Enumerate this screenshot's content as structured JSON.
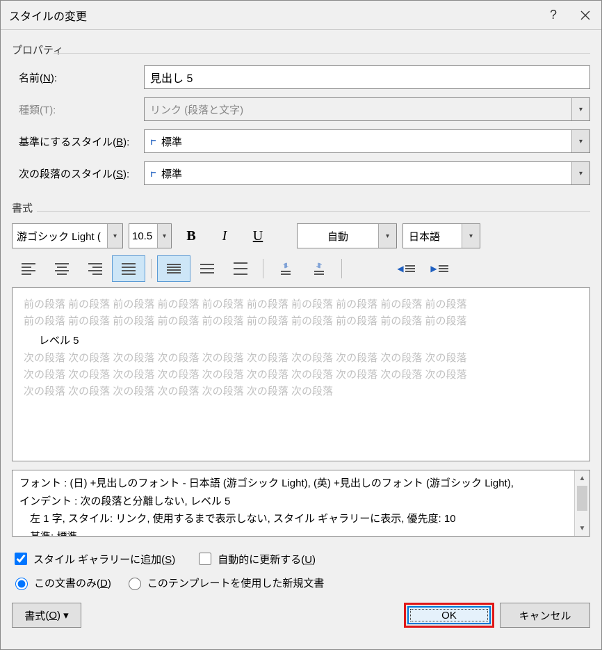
{
  "title": "スタイルの変更",
  "groups": {
    "properties": "プロパティ",
    "format": "書式"
  },
  "labels": {
    "name": "名前",
    "name_key": "N",
    "type": "種類",
    "type_key": "T",
    "based_on": "基準にするスタイル",
    "based_on_key": "B",
    "next_para": "次の段落のスタイル",
    "next_para_key": "S"
  },
  "values": {
    "name": "見出し 5",
    "type": "リンク (段落と文字)",
    "based_on": "標準",
    "next_para": "標準",
    "font": "游ゴシック Light (",
    "size": "10.5",
    "color": "自動",
    "lang": "日本語"
  },
  "preview": {
    "prev_para": "前の段落 前の段落 前の段落 前の段落 前の段落 前の段落 前の段落 前の段落 前の段落 前の段落",
    "sample": "レベル 5",
    "next_para": "次の段落 次の段落 次の段落 次の段落 次の段落 次の段落 次の段落 次の段落 次の段落 次の段落",
    "next_para2": "次の段落 次の段落 次の段落 次の段落 次の段落 次の段落 次の段落"
  },
  "description": {
    "line1": "フォント : (日) +見出しのフォント - 日本語 (游ゴシック Light), (英) +見出しのフォント (游ゴシック Light),",
    "line2": "インデント : 次の段落と分離しない, レベル 5",
    "line3": "　左  1 字, スタイル: リンク, 使用するまで表示しない, スタイル ギャラリーに表示, 優先度: 10",
    "line4": "　基準: 標準"
  },
  "checkboxes": {
    "add_gallery": "スタイル ギャラリーに追加",
    "add_gallery_key": "S",
    "auto_update": "自動的に更新する",
    "auto_update_key": "U"
  },
  "radios": {
    "doc_only": "この文書のみ",
    "doc_only_key": "D",
    "template": "このテンプレートを使用した新規文書"
  },
  "buttons": {
    "format": "書式",
    "format_key": "O",
    "ok": "OK",
    "cancel": "キャンセル"
  }
}
